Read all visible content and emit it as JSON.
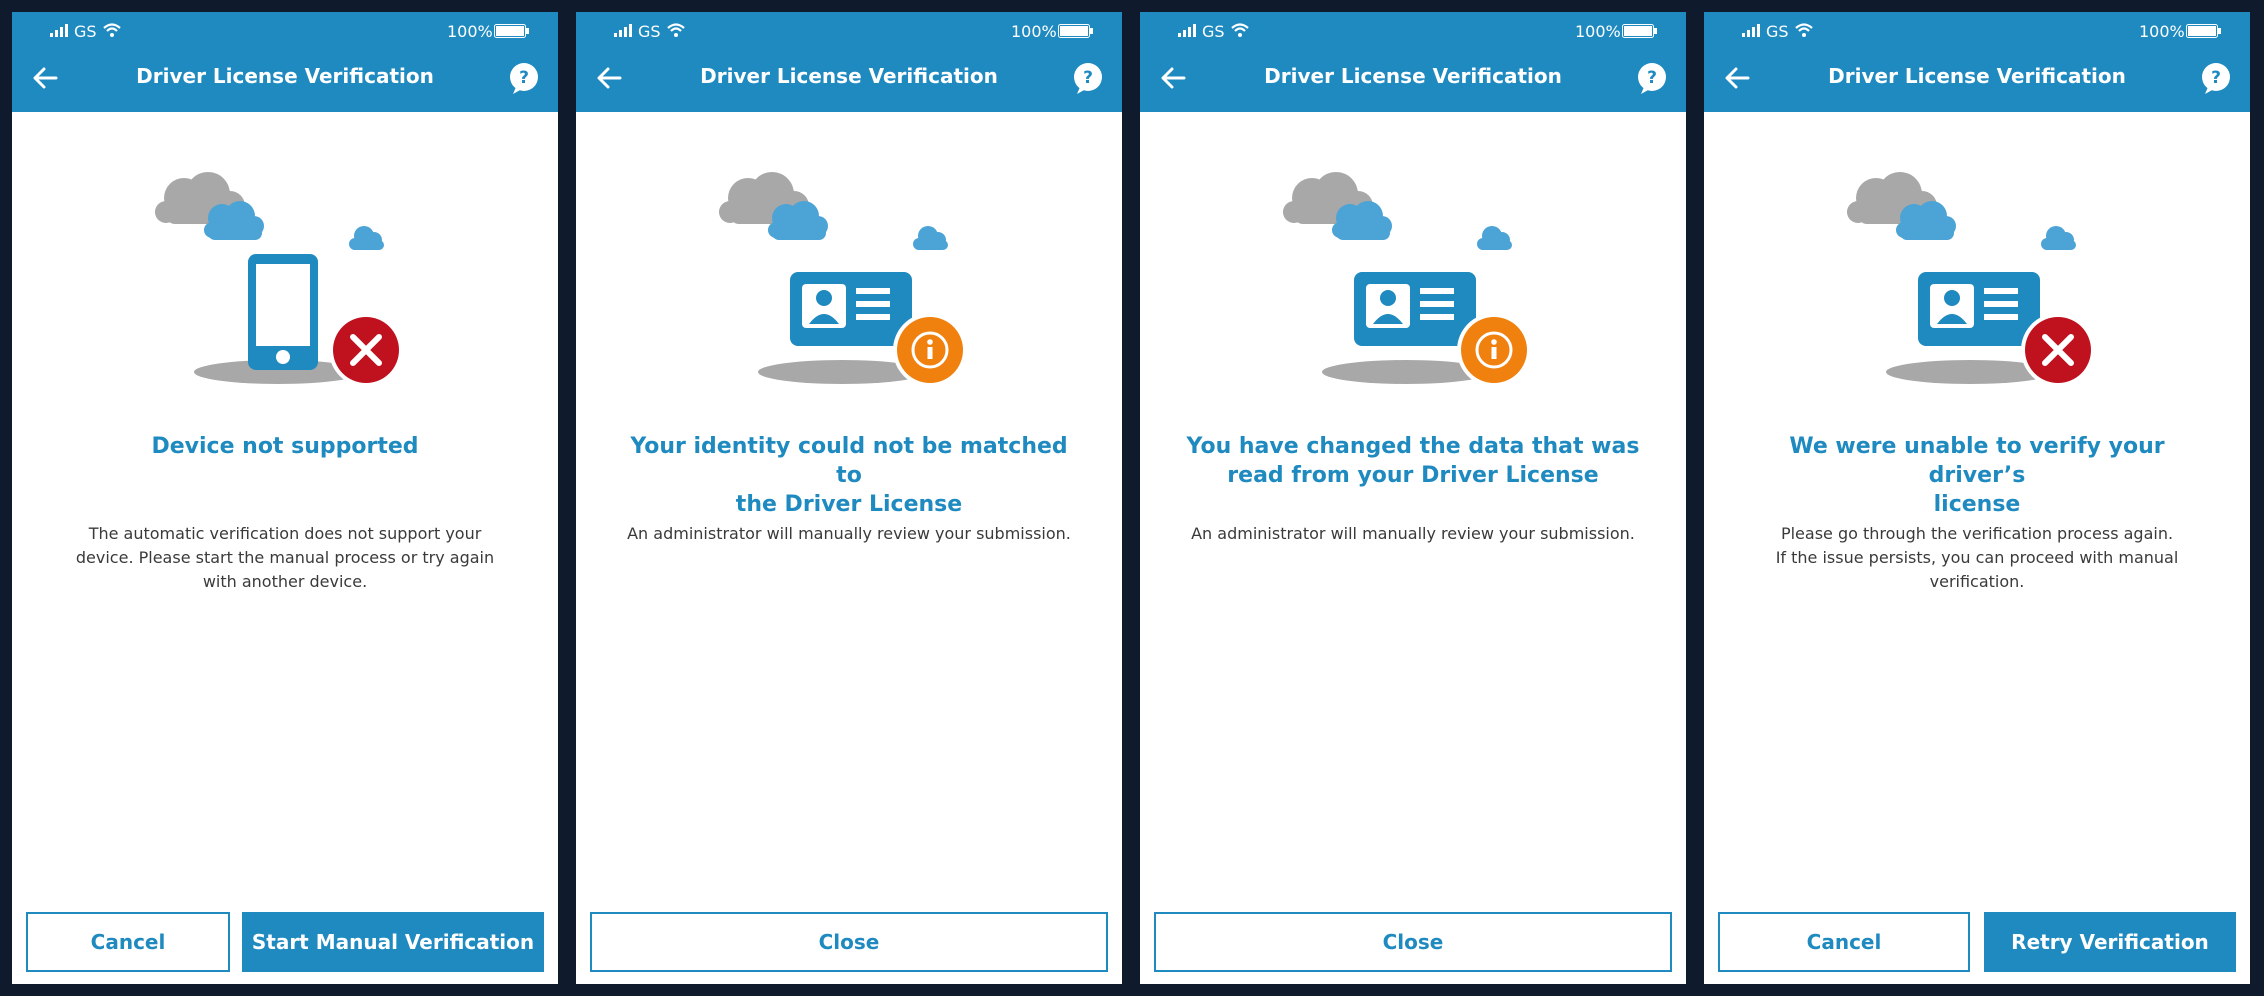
{
  "colors": {
    "primary": "#1f8ac0",
    "error": "#c0111f",
    "warning": "#f0810f",
    "background": "#0f1b2d"
  },
  "icons": [
    "signal-icon",
    "wifi-icon",
    "battery-icon",
    "back-arrow-icon",
    "help-icon",
    "cloud-icon",
    "phone-icon",
    "id-card-icon",
    "error-badge-icon",
    "info-badge-icon"
  ],
  "screens": [
    {
      "status": {
        "carrier": "GS",
        "battery": "100%"
      },
      "title": "Driver License Verification",
      "headline": "Device not supported",
      "body": "The automatic verification does not support your\ndevice. Please start the manual process or try again\nwith another device.",
      "secondary_button": "Cancel",
      "primary_button": "Start Manual Verification"
    },
    {
      "status": {
        "carrier": "GS",
        "battery": "100%"
      },
      "title": "Driver License Verification",
      "headline": "Your identity could not be matched to\nthe Driver License",
      "body": "An administrator will manually review your submission.",
      "close_button": "Close"
    },
    {
      "status": {
        "carrier": "GS",
        "battery": "100%"
      },
      "title": "Driver License Verification",
      "headline": "You have changed the data that was\nread from your Driver License",
      "body": "An administrator will manually review your submission.",
      "close_button": "Close"
    },
    {
      "status": {
        "carrier": "GS",
        "battery": "100%"
      },
      "title": "Driver License Verification",
      "headline": "We were unable to verify your driver’s\nlicense",
      "body": "Please go through the verification process again.\nIf the issue persists, you can proceed with manual\nverification.",
      "secondary_button": "Cancel",
      "primary_button": "Retry Verification"
    }
  ]
}
